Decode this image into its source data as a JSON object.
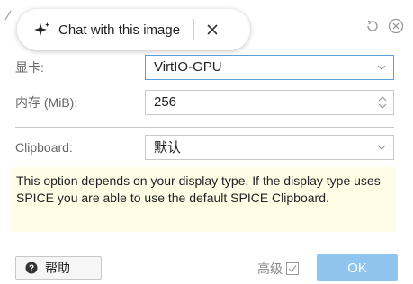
{
  "chat_overlay": {
    "label": "Chat with this image"
  },
  "form": {
    "display": {
      "label": "显卡:",
      "value": "VirtIO-GPU"
    },
    "memory": {
      "label": "内存 (MiB):",
      "value": "256"
    },
    "clipboard": {
      "label": "Clipboard:",
      "value": "默认"
    }
  },
  "info_text": "This option depends on your display type. If the display type uses SPICE you are able to use the default SPICE Clipboard.",
  "footer": {
    "help_label": "帮助",
    "advanced_label": "高级",
    "advanced_checked": false,
    "ok_label": "OK"
  },
  "colors": {
    "info_background": "#fffde6",
    "ok_button": "#8fc4ee",
    "focus_border": "#5aa0dc"
  }
}
